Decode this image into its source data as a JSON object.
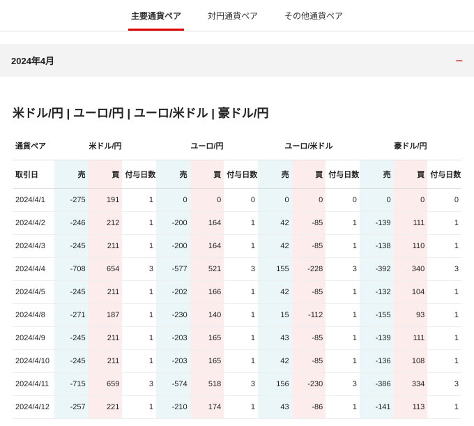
{
  "tabs": {
    "t0": "主要通貨ペア",
    "t1": "対円通貨ペア",
    "t2": "その他通貨ペア"
  },
  "accordion": {
    "label": "2024年4月",
    "icon": "−"
  },
  "title": "米ドル/円 | ユーロ/円 | ユーロ/米ドル | 豪ドル/円",
  "pairHeader": "通貨ペア",
  "pairs": {
    "p0": "米ドル/円",
    "p1": "ユーロ/円",
    "p2": "ユーロ/米ドル",
    "p3": "豪ドル/円"
  },
  "cols": {
    "date": "取引日",
    "sell": "売",
    "buy": "買",
    "days": "付与日数"
  },
  "chart_data": {
    "type": "table",
    "columns": [
      "取引日",
      "米ドル/円 売",
      "米ドル/円 買",
      "米ドル/円 付与日数",
      "ユーロ/円 売",
      "ユーロ/円 買",
      "ユーロ/円 付与日数",
      "ユーロ/米ドル 売",
      "ユーロ/米ドル 買",
      "ユーロ/米ドル 付与日数",
      "豪ドル/円 売",
      "豪ドル/円 買",
      "豪ドル/円 付与日数"
    ],
    "rows": [
      {
        "date": "2024/4/1",
        "c": [
          -275,
          191,
          1,
          0,
          0,
          0,
          0,
          0,
          0,
          0,
          0,
          0
        ]
      },
      {
        "date": "2024/4/2",
        "c": [
          -246,
          212,
          1,
          -200,
          164,
          1,
          42,
          -85,
          1,
          -139,
          111,
          1
        ]
      },
      {
        "date": "2024/4/3",
        "c": [
          -245,
          211,
          1,
          -200,
          164,
          1,
          42,
          -85,
          1,
          -138,
          110,
          1
        ]
      },
      {
        "date": "2024/4/4",
        "c": [
          -708,
          654,
          3,
          -577,
          521,
          3,
          155,
          -228,
          3,
          -392,
          340,
          3
        ]
      },
      {
        "date": "2024/4/5",
        "c": [
          -245,
          211,
          1,
          -202,
          166,
          1,
          42,
          -85,
          1,
          -132,
          104,
          1
        ]
      },
      {
        "date": "2024/4/8",
        "c": [
          -271,
          187,
          1,
          -230,
          140,
          1,
          15,
          -112,
          1,
          -155,
          93,
          1
        ]
      },
      {
        "date": "2024/4/9",
        "c": [
          -245,
          211,
          1,
          -203,
          165,
          1,
          43,
          -85,
          1,
          -139,
          111,
          1
        ]
      },
      {
        "date": "2024/4/10",
        "c": [
          -245,
          211,
          1,
          -203,
          165,
          1,
          42,
          -85,
          1,
          -136,
          108,
          1
        ]
      },
      {
        "date": "2024/4/11",
        "c": [
          -715,
          659,
          3,
          -574,
          518,
          3,
          156,
          -230,
          3,
          -386,
          334,
          3
        ]
      },
      {
        "date": "2024/4/12",
        "c": [
          -257,
          221,
          1,
          -210,
          174,
          1,
          43,
          -86,
          1,
          -141,
          113,
          1
        ]
      }
    ]
  }
}
